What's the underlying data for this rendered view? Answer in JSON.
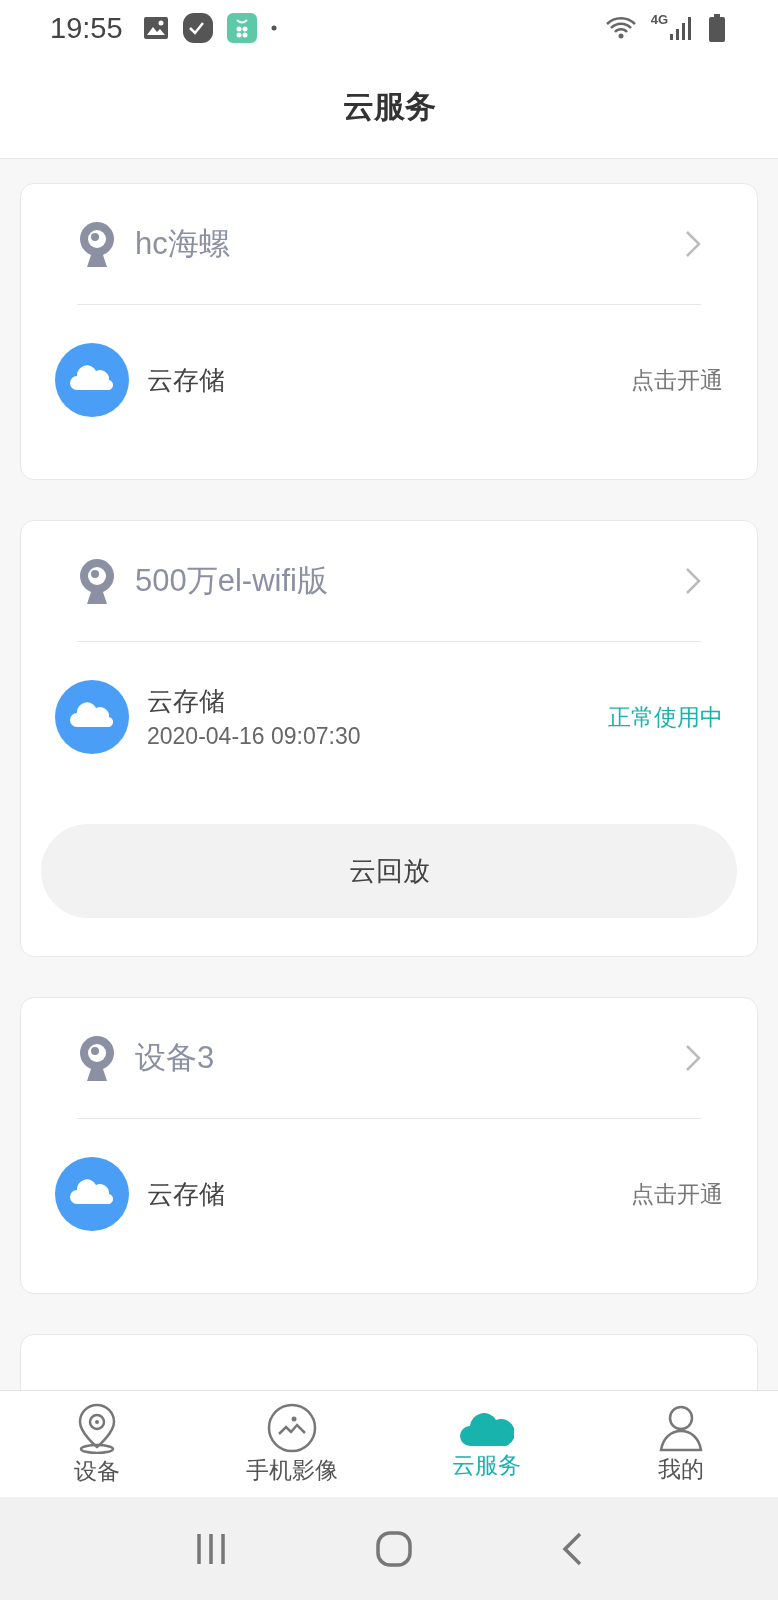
{
  "status_bar": {
    "time": "19:55",
    "network": "4G"
  },
  "header": {
    "title": "云服务"
  },
  "devices": [
    {
      "name": "hc海螺",
      "service": {
        "name": "云存储",
        "status": "点击开通",
        "active": false
      }
    },
    {
      "name": "500万el-wifi版",
      "service": {
        "name": "云存储",
        "date": "2020-04-16 09:07:30",
        "status": "正常使用中",
        "active": true
      },
      "playback_button": "云回放"
    },
    {
      "name": "设备3",
      "service": {
        "name": "云存储",
        "status": "点击开通",
        "active": false
      }
    }
  ],
  "bottom_tabs": [
    {
      "kind": "device",
      "label": "设备",
      "selected": false
    },
    {
      "kind": "gallery",
      "label": "手机影像",
      "selected": false
    },
    {
      "kind": "cloud",
      "label": "云服务",
      "selected": true
    },
    {
      "kind": "profile",
      "label": "我的",
      "selected": false
    }
  ]
}
